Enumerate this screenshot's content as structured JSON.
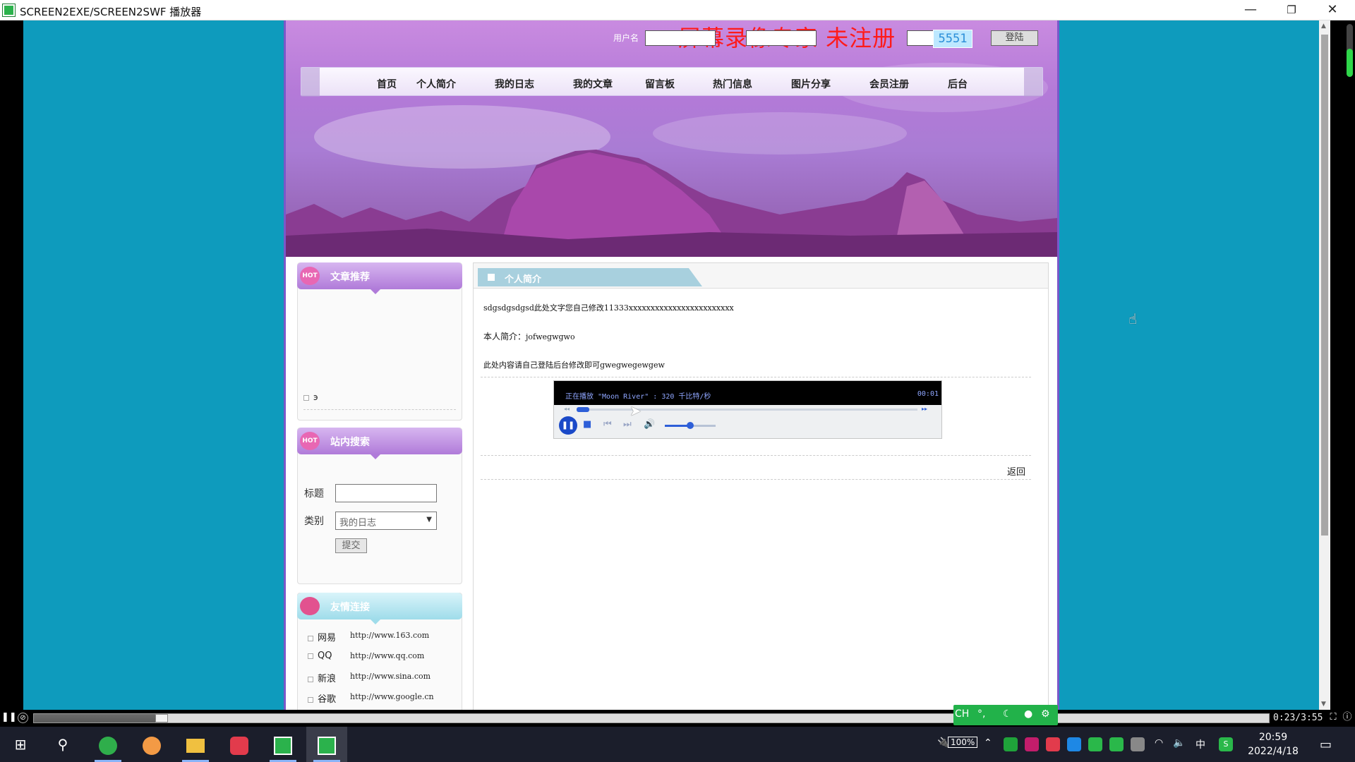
{
  "window": {
    "title": "SCREEN2EXE/SCREEN2SWF 播放器",
    "minimize_label": "—",
    "restore_label": "❐",
    "close_label": "✕"
  },
  "site": {
    "watermark": "屏幕录像专家 未注册",
    "login": {
      "username_label": "用户名",
      "captcha": "5551",
      "submit_label": "登陆"
    },
    "nav": [
      "首页",
      "个人简介",
      "我的日志",
      "我的文章",
      "留言板",
      "热门信息",
      "图片分享",
      "会员注册",
      "后台"
    ],
    "sidebar": {
      "recommend_title": "文章推荐",
      "recommend_badge": "HOT",
      "recommend_item": "э",
      "search_title": "站内搜索",
      "search_badge": "HOT",
      "title_label": "标题",
      "title_value": "",
      "category_label": "类别",
      "category_value": "我的日志",
      "submit_label": "提交",
      "links_title": "友情连接",
      "links": [
        {
          "name": "网易",
          "url": "http://www.163.com"
        },
        {
          "name": "QQ",
          "url": "http://www.qq.com"
        },
        {
          "name": "新浪",
          "url": "http://www.sina.com"
        },
        {
          "name": "谷歌",
          "url": "http://www.google.cn"
        }
      ]
    },
    "main": {
      "section_title": "个人简介",
      "line1": "sdgsdgsdgsd此处文字您自己修改11333xxxxxxxxxxxxxxxxxxxxxxxx",
      "line2_prefix": "本人简介：",
      "line2_value": "jofwegwgwo",
      "line3": "此处内容请自己登陆后台修改即可gwegwegewgew",
      "back_label": "返回",
      "player": {
        "now_playing": "正在播放 \"Moon River\" : 320 千比特/秒",
        "time": "00:01",
        "progress": 0.03,
        "volume": 0.5
      }
    }
  },
  "playback": {
    "position_label": "0:23/3:55",
    "progress": 0.098
  },
  "ime": {
    "lang": "CH",
    "punct": "°,"
  },
  "taskbar": {
    "battery": "100%",
    "ime_char": "中",
    "time": "20:59",
    "date": "2022/4/18"
  },
  "colors": {
    "page_bg": "#0e9bbd",
    "accent_purple": "#b07bd9",
    "watermark_red": "#ff1a1a",
    "ime_green": "#22b24a"
  }
}
